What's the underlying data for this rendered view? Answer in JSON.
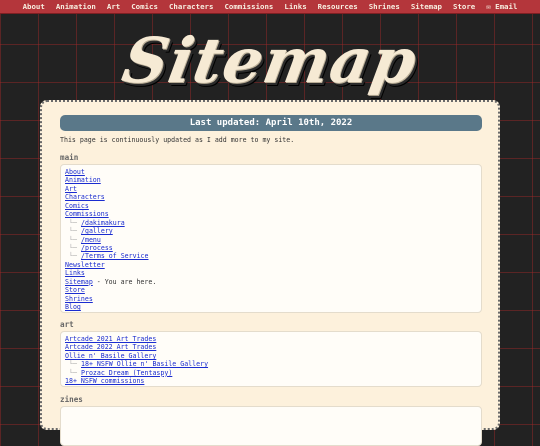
{
  "nav": [
    "About",
    "Animation",
    "Art",
    "Comics",
    "Characters",
    "Commissions",
    "Links",
    "Resources",
    "Shrines",
    "Sitemap",
    "Store",
    "✉ Email"
  ],
  "title": "Sitemap",
  "updated": "Last updated: April 10th, 2022",
  "intro": "This page is continuously updated as I add more to my site.",
  "sections": {
    "main": {
      "title": "main",
      "items": [
        {
          "label": "About",
          "sub": false
        },
        {
          "label": "Animation",
          "sub": false
        },
        {
          "label": "Art",
          "sub": false
        },
        {
          "label": "Characters",
          "sub": false
        },
        {
          "label": "Comics",
          "sub": false
        },
        {
          "label": "Commissions",
          "sub": false
        },
        {
          "label": "/dakimakura",
          "sub": true
        },
        {
          "label": "/gallery",
          "sub": true
        },
        {
          "label": "/menu",
          "sub": true
        },
        {
          "label": "/process",
          "sub": true
        },
        {
          "label": "/Terms of Service",
          "sub": true
        },
        {
          "label": "Newsletter",
          "sub": false
        },
        {
          "label": "Links",
          "sub": false
        },
        {
          "label": "Sitemap",
          "sub": false,
          "note": " - You are here."
        },
        {
          "label": "Store",
          "sub": false
        },
        {
          "label": "Shrines",
          "sub": false
        },
        {
          "label": "Blog",
          "sub": false
        }
      ]
    },
    "art": {
      "title": "art",
      "items": [
        {
          "label": "Artcade 2021 Art Trades",
          "sub": false
        },
        {
          "label": "Artcade 2022 Art Trades",
          "sub": false
        },
        {
          "label": "Ollie n' Basile Gallery",
          "sub": false
        },
        {
          "label": "18+ NSFW Ollie n' Basile Gallery",
          "sub": true
        },
        {
          "label": "Prozac Dream (Tentaspy)",
          "sub": true
        },
        {
          "label": "18+ NSFW commissions",
          "sub": false
        }
      ]
    },
    "zines": {
      "title": "zines"
    }
  },
  "colors": {
    "nav_bg": "#b4363b",
    "updated_bg": "#5a7889",
    "panel_bg": "#fdf1dc",
    "link": "#1a2cd0"
  }
}
